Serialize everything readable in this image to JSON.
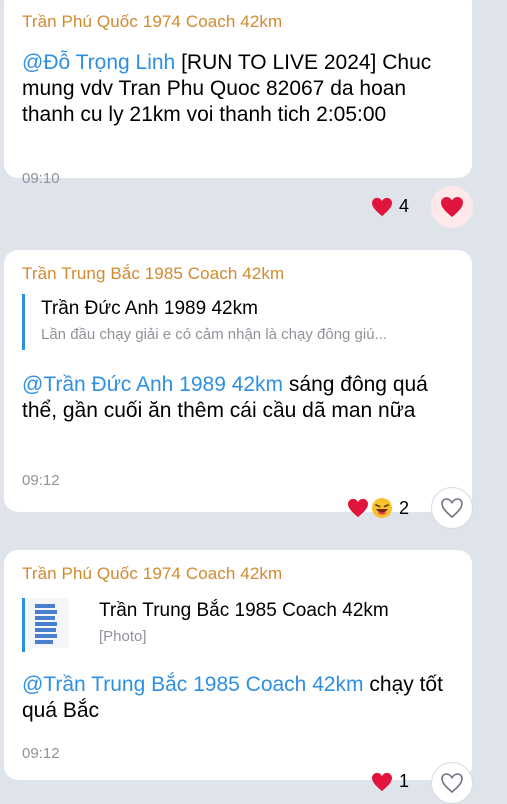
{
  "messages": [
    {
      "author": "Trần Phú Quốc 1974 Coach 42km",
      "mention": "@Đỗ Trọng Linh",
      "text": " [RUN TO LIVE 2024] Chuc mung vdv Tran Phu Quoc 82067 da hoan thanh cu ly 21km voi thanh tich 2:05:00",
      "time": "09:10",
      "reaction_count": "4",
      "reaction_icon": "heart-icon",
      "my_reaction": "heart"
    },
    {
      "author": "Trần Trung Bắc 1985 Coach 42km",
      "reply": {
        "title": "Trần Đức Anh 1989 42km",
        "preview": "Lần đầu chạy giải e có cảm nhận là chạy đông giú..."
      },
      "mention": "@Trần Đức Anh 1989 42km",
      "text": " sáng đông quá thể, gần cuối ăn thêm cái cầu dã man nữa",
      "time": "09:12",
      "reaction_count": "2",
      "reaction_icons": [
        "heart-icon",
        "laughing-face-icon"
      ],
      "my_reaction": "none"
    },
    {
      "author": "Trần Phú Quốc 1974 Coach 42km",
      "reply": {
        "title": "Trần Trung Bắc 1985 Coach 42km",
        "preview": "[Photo]"
      },
      "mention": "@Trần Trung Bắc 1985 Coach 42km",
      "text": " chạy tốt quá Bắc",
      "time": "09:12",
      "reaction_count": "1",
      "reaction_icon": "heart-icon",
      "my_reaction": "none"
    }
  ],
  "colors": {
    "author": "#d28a2e",
    "mention": "#2f8fe3",
    "background": "#dfe3ea",
    "heart": "#e0143c"
  }
}
